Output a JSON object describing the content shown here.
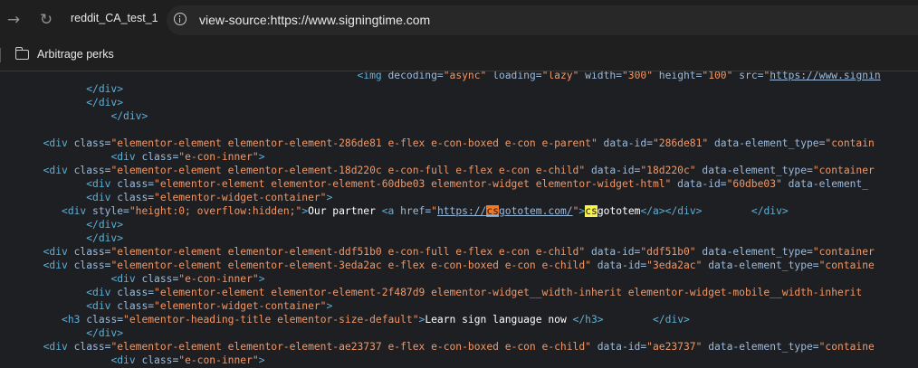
{
  "browser": {
    "back_icon": "→",
    "reload_icon": "↻",
    "tab_title": "reddit_CA_test_1",
    "url": "view-source:https://www.signingtime.com",
    "bookmark_label": "Arbitrage perks"
  },
  "source": {
    "line0": {
      "indent": "                                                          ",
      "tag": "<img ",
      "a1": "decoding=",
      "v1": "\"async\" ",
      "a2": "loading=",
      "v2": "\"lazy\" ",
      "a3": "width=",
      "v3": "\"300\" ",
      "a4": "height=",
      "v4": "\"100\" ",
      "a5": "src=",
      "v5": "\"",
      "link": "https://www.signin"
    },
    "line1": {
      "indent": "              ",
      "tag": "</div>"
    },
    "line2": {
      "indent": "              ",
      "tag": "</div>"
    },
    "line3": {
      "indent": "                  ",
      "tag": "</div>"
    },
    "line4": {
      "indent": "       ",
      "tag": "<div ",
      "a1": "class=",
      "v1": "\"elementor-element elementor-element-286de81 e-flex e-con-boxed e-con e-parent\" ",
      "a2": "data-id=",
      "v2": "\"286de81\" ",
      "a3": "data-element_type=",
      "v3": "\"contain"
    },
    "line5": {
      "indent": "                  ",
      "tag": "<div ",
      "a1": "class=",
      "v1": "\"e-con-inner\"",
      "end": ">"
    },
    "line6": {
      "indent": "       ",
      "tag": "<div ",
      "a1": "class=",
      "v1": "\"elementor-element elementor-element-18d220c e-con-full e-flex e-con e-child\" ",
      "a2": "data-id=",
      "v2": "\"18d220c\" ",
      "a3": "data-element_type=",
      "v3": "\"container"
    },
    "line7": {
      "indent": "              ",
      "tag": "<div ",
      "a1": "class=",
      "v1": "\"elementor-element elementor-element-60dbe03 elementor-widget elementor-widget-html\" ",
      "a2": "data-id=",
      "v2": "\"60dbe03\" ",
      "a3": "data-element_"
    },
    "line8": {
      "indent": "              ",
      "tag": "<div ",
      "a1": "class=",
      "v1": "\"elementor-widget-container\"",
      "end": ">"
    },
    "line9": {
      "indent": "          ",
      "tag": "<div ",
      "a1": "style=",
      "v1": "\"height:0; overflow:hidden;\"",
      "end": ">",
      "text1": "Our partner ",
      "tag2": "<a ",
      "a2": "href=",
      "q1": "\"",
      "link_pre": "https://",
      "link_hl": "cs",
      "link_post": "gototem.com/",
      "q2": "\"",
      "end2": ">",
      "text_hl": "cs",
      "text2": "gototem",
      "close_a": "</a></div>",
      "gap": "        ",
      "close_div": "</div>"
    },
    "line10": {
      "indent": "              ",
      "tag": "</div>"
    },
    "line11": {
      "indent": "              ",
      "tag": "</div>"
    },
    "line12": {
      "indent": "       ",
      "tag": "<div ",
      "a1": "class=",
      "v1": "\"elementor-element elementor-element-ddf51b0 e-con-full e-flex e-con e-child\" ",
      "a2": "data-id=",
      "v2": "\"ddf51b0\" ",
      "a3": "data-element_type=",
      "v3": "\"container"
    },
    "line13": {
      "indent": "       ",
      "tag": "<div ",
      "a1": "class=",
      "v1": "\"elementor-element elementor-element-3eda2ac e-flex e-con-boxed e-con e-child\" ",
      "a2": "data-id=",
      "v2": "\"3eda2ac\" ",
      "a3": "data-element_type=",
      "v3": "\"containe"
    },
    "line14": {
      "indent": "                  ",
      "tag": "<div ",
      "a1": "class=",
      "v1": "\"e-con-inner\"",
      "end": ">"
    },
    "line15": {
      "indent": "              ",
      "tag": "<div ",
      "a1": "class=",
      "v1": "\"elementor-element elementor-element-2f487d9 elementor-widget__width-inherit elementor-widget-mobile__width-inherit "
    },
    "line16": {
      "indent": "              ",
      "tag": "<div ",
      "a1": "class=",
      "v1": "\"elementor-widget-container\"",
      "end": ">"
    },
    "line17": {
      "indent": "          ",
      "tag": "<h3 ",
      "a1": "class=",
      "v1": "\"elementor-heading-title elementor-size-default\"",
      "end": ">",
      "text": "Learn sign language now ",
      "close": "</h3>",
      "gap": "        ",
      "close_div": "</div>"
    },
    "line18": {
      "indent": "              ",
      "tag": "</div>"
    },
    "line19": {
      "indent": "       ",
      "tag": "<div ",
      "a1": "class=",
      "v1": "\"elementor-element elementor-element-ae23737 e-flex e-con-boxed e-con e-child\" ",
      "a2": "data-id=",
      "v2": "\"ae23737\" ",
      "a3": "data-element_type=",
      "v3": "\"containe"
    },
    "line20": {
      "indent": "                  ",
      "tag": "<div ",
      "a1": "class=",
      "v1": "\"e-con-inner\"",
      "end": ">"
    }
  }
}
